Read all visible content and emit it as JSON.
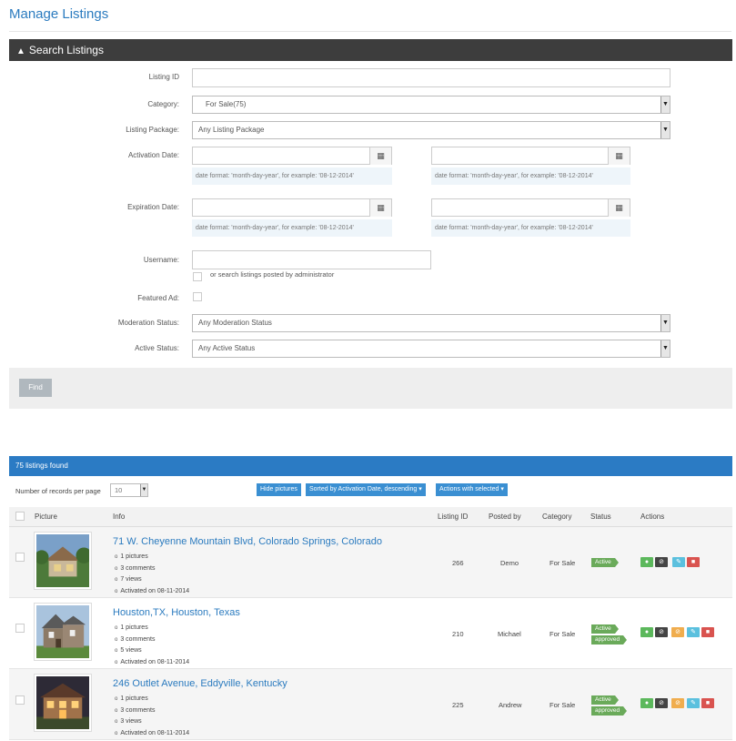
{
  "page": {
    "title": "Manage Listings"
  },
  "search": {
    "header": "Search Listings",
    "labels": {
      "listing_id": "Listing ID",
      "category": "Category:",
      "package": "Listing Package:",
      "activation": "Activation Date:",
      "expiration": "Expiration Date:",
      "username": "Username:",
      "featured": "Featured Ad:",
      "moderation": "Moderation Status:",
      "active": "Active Status:"
    },
    "category_value": "For Sale(75)",
    "package_value": "Any Listing Package",
    "date_hint": "date format: 'month-day-year', for example: '08-12-2014'",
    "admin_option": "or search listings posted by administrator",
    "moderation_value": "Any Moderation Status",
    "active_value": "Any Active Status",
    "find_label": "Find"
  },
  "results": {
    "count_text": "75 listings found",
    "rpp_label": "Number of records per page",
    "rpp_value": "10",
    "hide_pictures": "Hide pictures",
    "sorted_by": "Sorted by Activation Date, descending",
    "actions_selected": "Actions with selected",
    "columns": {
      "picture": "Picture",
      "info": "Info",
      "listing_id": "Listing ID",
      "posted_by": "Posted by",
      "category": "Category",
      "status": "Status",
      "actions": "Actions"
    },
    "listings": [
      {
        "title": "71 W. Cheyenne Mountain Blvd, Colorado Springs, Colorado",
        "pictures": "1 pictures",
        "comments": "3 comments",
        "views": "7 views",
        "activated": "Activated on 08-11-2014",
        "id": "266",
        "posted_by": "Demo",
        "category": "For Sale",
        "status1": "Active",
        "status2": ""
      },
      {
        "title": "Houston,TX, Houston, Texas",
        "pictures": "1 pictures",
        "comments": "3 comments",
        "views": "5 views",
        "activated": "Activated on 08-11-2014",
        "id": "210",
        "posted_by": "Michael",
        "category": "For Sale",
        "status1": "Active",
        "status2": "approved"
      },
      {
        "title": "246 Outlet Avenue, Eddyville, Kentucky",
        "pictures": "1 pictures",
        "comments": "3 comments",
        "views": "3 views",
        "activated": "Activated on 08-11-2014",
        "id": "225",
        "posted_by": "Andrew",
        "category": "For Sale",
        "status1": "Active",
        "status2": "approved"
      }
    ]
  },
  "icons": {
    "collapse": "chevron-up-icon",
    "calendar": "calendar-icon",
    "actions": [
      "comment-icon",
      "deactivate-icon",
      "block-icon",
      "edit-icon",
      "delete-icon"
    ]
  },
  "colors": {
    "link": "#2b7bbf",
    "header_dark": "#3d3d3d",
    "results_bar": "#2b7bc4",
    "status_green": "#6aaa5a",
    "action_green": "#5cb85c",
    "action_dark": "#444444",
    "action_orange": "#f0ad4e",
    "action_blue": "#5bc0de",
    "action_red": "#d9534f"
  }
}
